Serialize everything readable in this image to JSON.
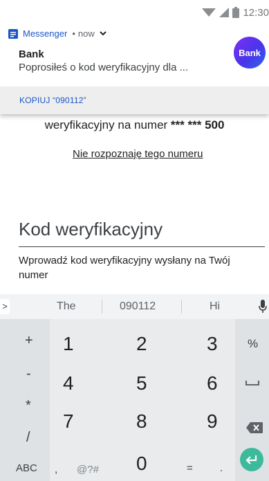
{
  "status_bar": {
    "time": "12:30",
    "icons": [
      "wifi-icon",
      "signal-icon",
      "battery-icon"
    ]
  },
  "notification": {
    "app_name": "Messenger",
    "separator": "•",
    "time": "now",
    "title": "Bank",
    "text": "Poprosiłeś o kod weryfikacyjny dla ...",
    "avatar_text": "Bank",
    "action_label": "KOPIUJ “090112”",
    "accent_color": "#1a56c9"
  },
  "content": {
    "verify_prefix": "weryfikacyjny na numer",
    "masked_number": "*** *** 500",
    "unknown_number_link": "Nie rozpoznaję tego numeru",
    "code_label": "Kod weryfikacyjny",
    "code_hint": "Wprowadź kod weryfikacyjny wysłany na Twój numer"
  },
  "keyboard": {
    "expand_label": ">",
    "suggestions": [
      "The",
      "090112",
      "Hi"
    ],
    "keys": {
      "plus": "+",
      "minus": "-",
      "asterisk": "*",
      "slash": "/",
      "abc": "ABC",
      "comma": ",",
      "symbols": "@?#",
      "one": "1",
      "two": "2",
      "three": "3",
      "four": "4",
      "five": "5",
      "six": "6",
      "seven": "7",
      "eight": "8",
      "nine": "9",
      "zero": "0",
      "equals": "=",
      "period": ".",
      "percent": "%"
    },
    "enter_color": "#3dba9b"
  }
}
